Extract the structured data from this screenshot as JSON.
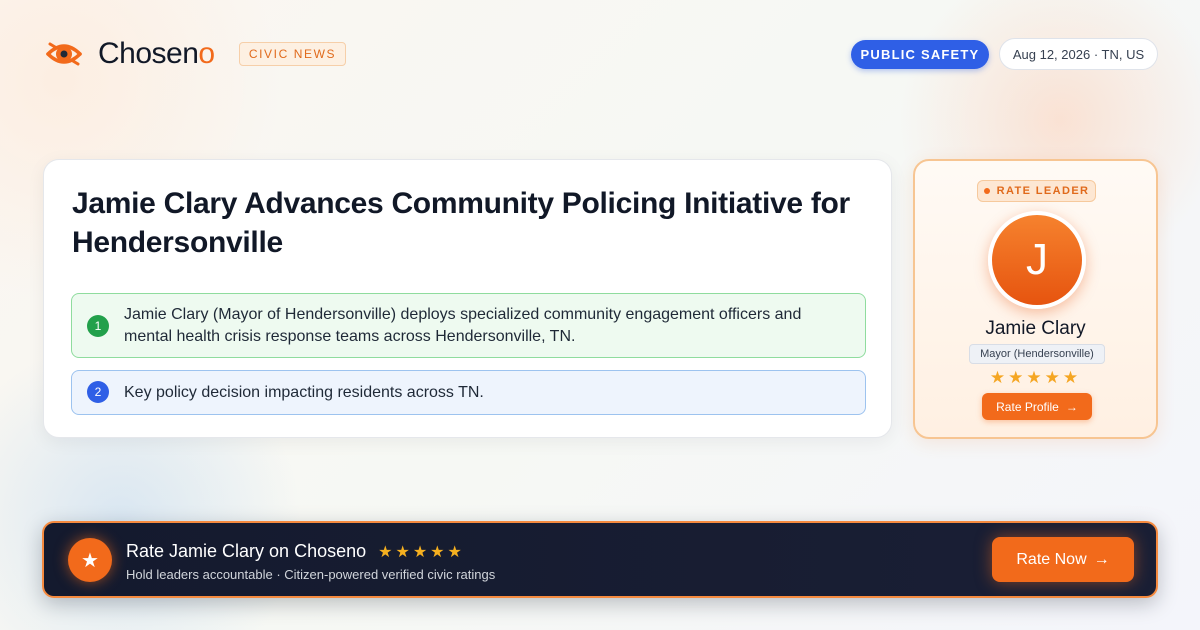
{
  "brand": {
    "name_main": "Chosen",
    "name_accent": "o",
    "section_badge": "CIVIC NEWS",
    "accent_color": "#f26a1b"
  },
  "header": {
    "topic": "PUBLIC SAFETY",
    "date_location": "Aug 12, 2026 · TN, US",
    "topic_color": "#2f5fe6"
  },
  "article": {
    "headline": "Jamie Clary Advances Community Policing Initiative for Hendersonville",
    "points": [
      {
        "number": "1",
        "text": "Jamie Clary (Mayor of Hendersonville) deploys specialized community engagement officers and mental health crisis response teams across Hendersonville, TN."
      },
      {
        "number": "2",
        "text": "Key policy decision impacting residents across TN."
      }
    ]
  },
  "leader_card": {
    "badge": "RATE LEADER",
    "initial": "J",
    "name": "Jamie Clary",
    "role": "Mayor (Hendersonville)",
    "stars": "★★★★★",
    "button_label": "Rate Profile",
    "button_arrow": "→"
  },
  "cta": {
    "icon": "star-icon",
    "icon_glyph": "★",
    "title": "Rate Jamie Clary on Choseno",
    "stars": "★★★★★",
    "subtitle": "Hold leaders accountable · Citizen-powered verified civic ratings",
    "button_label": "Rate Now",
    "button_arrow": "→"
  }
}
